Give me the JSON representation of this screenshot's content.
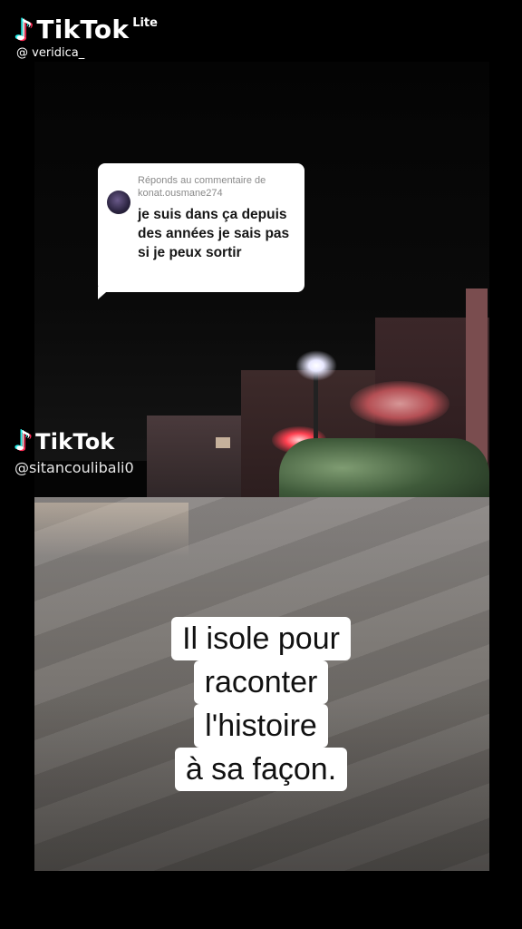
{
  "watermark_top": {
    "brand": "TikTok",
    "badge": "Lite",
    "handle": "@ veridica_"
  },
  "reply": {
    "header": "Réponds au commentaire de konat.ousmane274",
    "text": "je suis dans ça depuis des années je sais pas si je peux sortir"
  },
  "watermark_mid": {
    "brand": "TikTok",
    "handle": "@sitancoulibali0"
  },
  "caption": {
    "lines": [
      "Il isole pour",
      "raconter",
      "l'histoire",
      "à sa façon."
    ]
  },
  "icons": {
    "logo": "tiktok-note-icon",
    "avatar": "commenter-avatar"
  },
  "colors": {
    "cyan": "#25f4ee",
    "pink": "#fe2c55",
    "caption_bg": "#ffffff"
  }
}
